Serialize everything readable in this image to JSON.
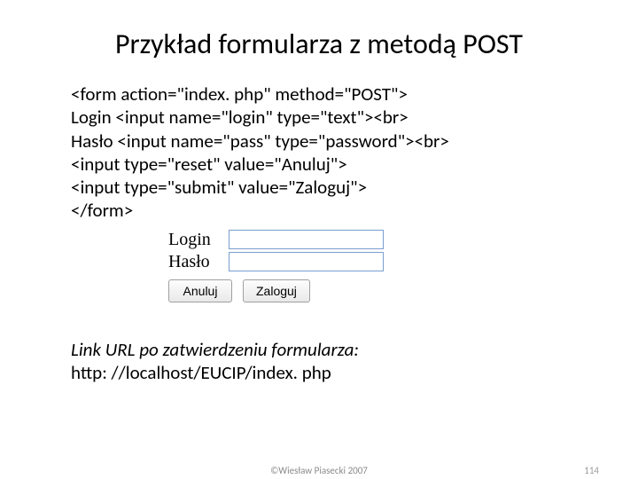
{
  "title": "Przykład formularza z metodą POST",
  "code": {
    "line1": "<form action=\"index. php\" method=\"POST\">",
    "line2": "Login <input name=\"login\" type=\"text\"><br>",
    "line3": "Hasło <input name=\"pass\" type=\"password\"><br>",
    "line4": "<input type=\"reset\" value=\"Anuluj\">",
    "line5": "<input type=\"submit\" value=\"Zaloguj\">",
    "line6": "</form>"
  },
  "form": {
    "login_label": "Login",
    "password_label": "Hasło",
    "login_value": "",
    "password_value": "",
    "reset_label": "Anuluj",
    "submit_label": "Zaloguj"
  },
  "link_note": "Link URL po zatwierdzeniu formularza:",
  "url_value": "http: //localhost/EUCIP/index. php",
  "footer": {
    "copyright": "©Wiesław Piasecki 2007",
    "page": "114"
  }
}
